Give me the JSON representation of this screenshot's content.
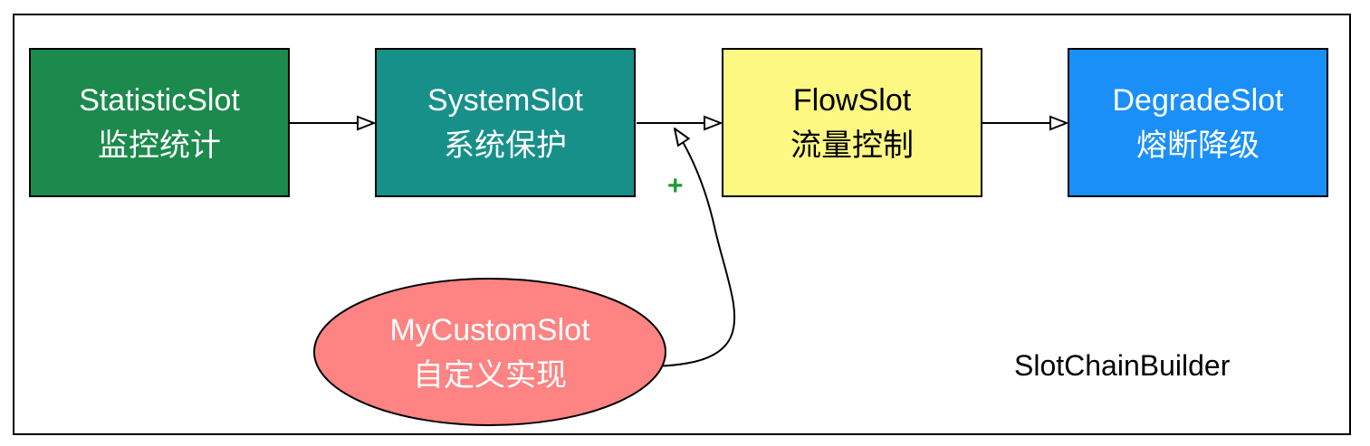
{
  "slots": [
    {
      "id": "statistic",
      "name": "StatisticSlot",
      "desc": "监控统计",
      "fill": "#1b8a4c",
      "text_color": "#ffffff"
    },
    {
      "id": "system",
      "name": "SystemSlot",
      "desc": "系统保护",
      "fill": "#17908a",
      "text_color": "#ffffff"
    },
    {
      "id": "flow",
      "name": "FlowSlot",
      "desc": "流量控制",
      "fill": "#fdf882",
      "text_color": "#000000"
    },
    {
      "id": "degrade",
      "name": "DegradeSlot",
      "desc": "熔断降级",
      "fill": "#1a8ff8",
      "text_color": "#ffffff"
    }
  ],
  "custom_slot": {
    "name": "MyCustomSlot",
    "desc": "自定义实现",
    "fill": "#fe8383"
  },
  "insert_marker": "+",
  "insert_marker_color": "#1f9a2f",
  "builder_label": "SlotChainBuilder"
}
